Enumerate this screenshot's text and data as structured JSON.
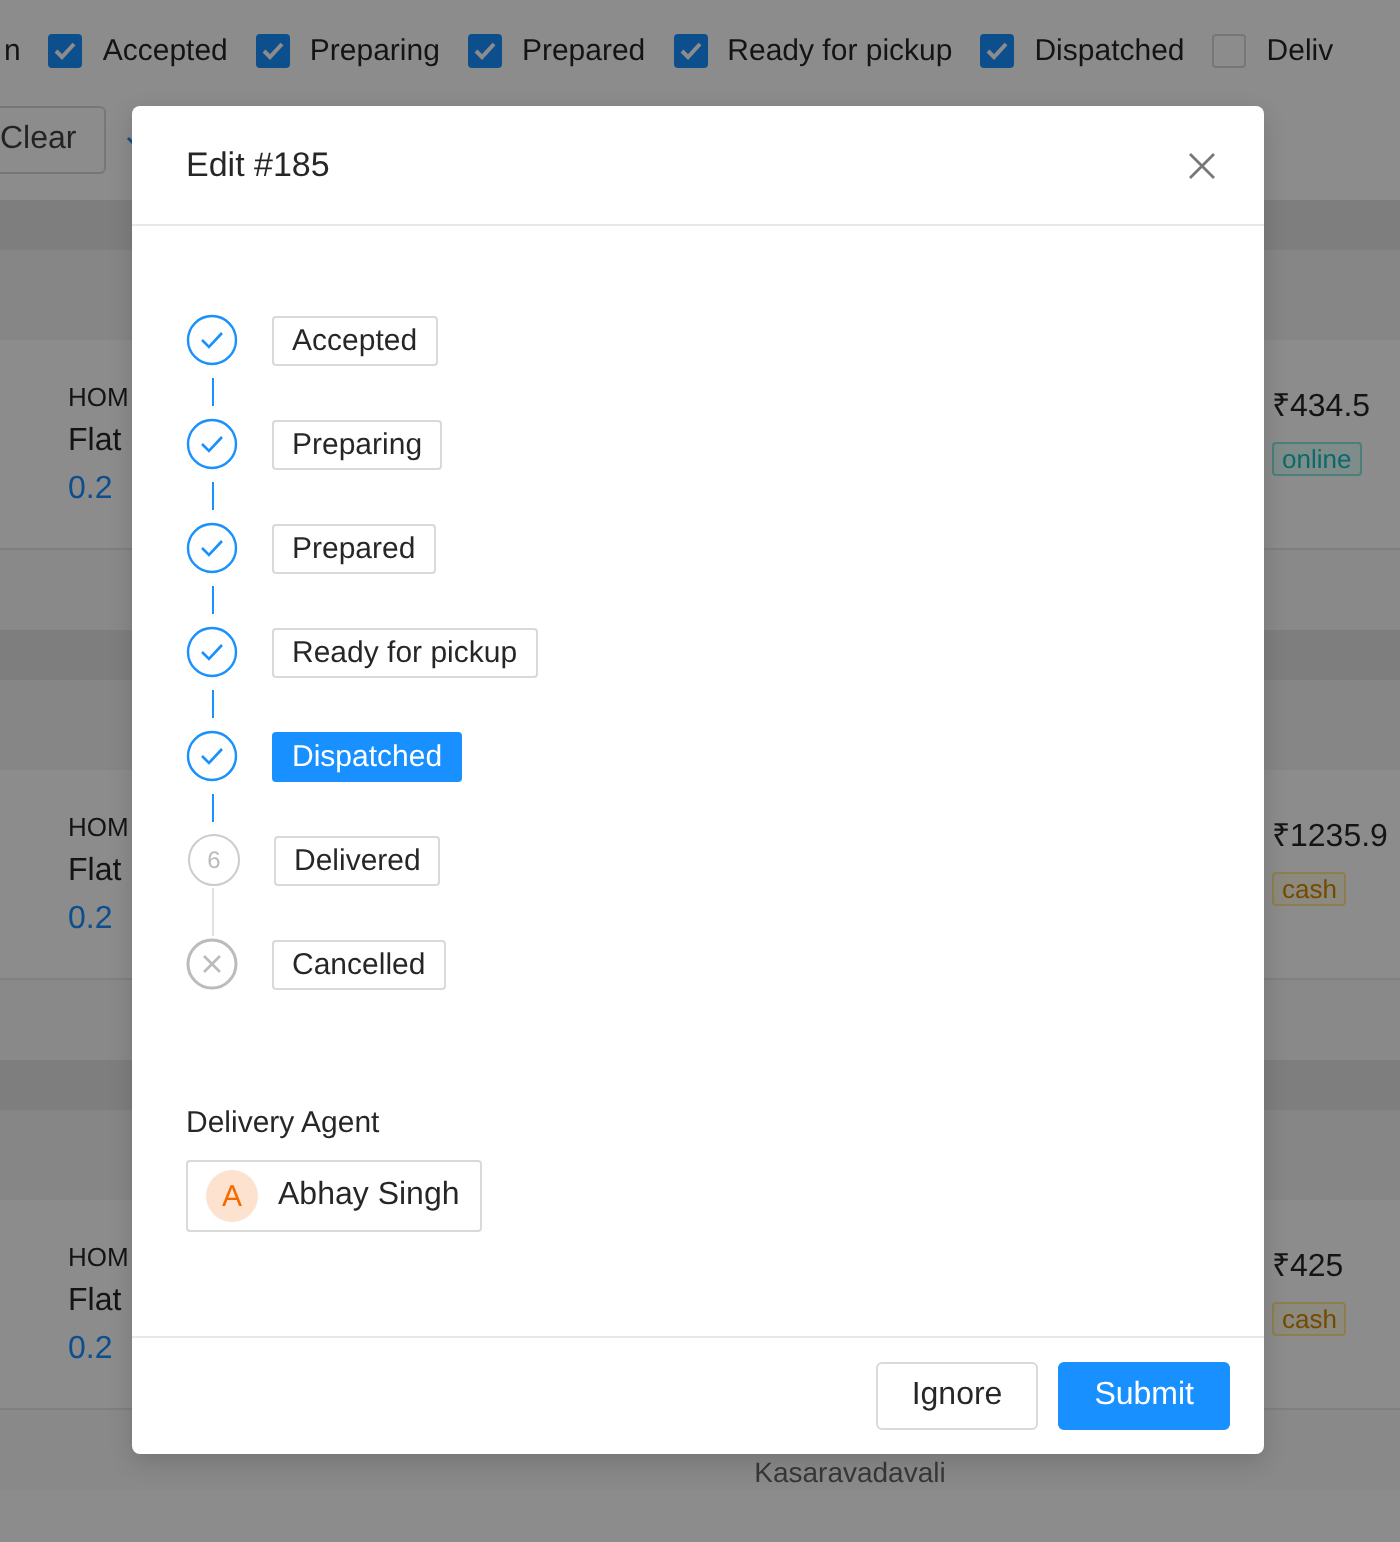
{
  "filters": {
    "lead": "n",
    "items": [
      {
        "label": "Accepted",
        "checked": true
      },
      {
        "label": "Preparing",
        "checked": true
      },
      {
        "label": "Prepared",
        "checked": true
      },
      {
        "label": "Ready for pickup",
        "checked": true
      },
      {
        "label": "Dispatched",
        "checked": true
      },
      {
        "label": "Deliv",
        "checked": false
      }
    ]
  },
  "clear_button": "Clear",
  "orders": [
    {
      "line_1": "HOM",
      "line_2": "Flat",
      "distance": "0.2",
      "amount": "₹434.5",
      "payment": {
        "label": "online",
        "kind": "online"
      }
    },
    {
      "line_1": "HOM",
      "line_2": "Flat",
      "distance": "0.2",
      "amount": "₹1235.9",
      "payment": {
        "label": "cash",
        "kind": "cash"
      }
    },
    {
      "line_1": "HOM",
      "line_2": "Flat",
      "distance": "0.2",
      "amount": "₹425",
      "payment": {
        "label": "cash",
        "kind": "cash"
      },
      "footer": "Kasaravadavali"
    }
  ],
  "modal": {
    "title": "Edit #185",
    "steps": [
      {
        "label": "Accepted",
        "kind": "done",
        "selected": false
      },
      {
        "label": "Preparing",
        "kind": "done",
        "selected": false
      },
      {
        "label": "Prepared",
        "kind": "done",
        "selected": false
      },
      {
        "label": "Ready for pickup",
        "kind": "done",
        "selected": false
      },
      {
        "label": "Dispatched",
        "kind": "done",
        "selected": true
      },
      {
        "label": "Delivered",
        "kind": "pending",
        "number": "6",
        "selected": false
      },
      {
        "label": "Cancelled",
        "kind": "cancelled",
        "selected": false
      }
    ],
    "agent": {
      "label": "Delivery Agent",
      "initial": "A",
      "name": "Abhay Singh"
    },
    "buttons": [
      {
        "label": "Ignore",
        "kind": "default"
      },
      {
        "label": "Submit",
        "kind": "primary"
      }
    ]
  }
}
